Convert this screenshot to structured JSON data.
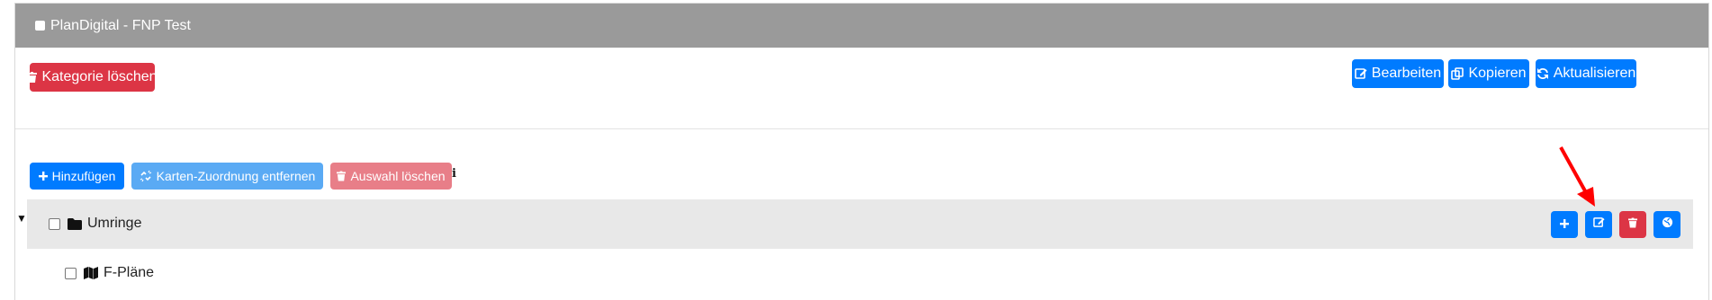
{
  "card": {
    "title": "PlanDigital - FNP Test"
  },
  "toolbar": {
    "delete_category_label": "Kategorie löschen",
    "edit_label": "Bearbeiten",
    "copy_label": "Kopieren",
    "refresh_label": "Aktualisieren"
  },
  "tree_toolbar": {
    "add_label": "Hinzufügen",
    "remove_map_assignment_label": "Karten-Zuordnung entfernen",
    "clear_selection_label": "Auswahl löschen",
    "info_icon": "info-icon"
  },
  "tree": {
    "items": [
      {
        "label": "Umringe",
        "icon": "folder-icon",
        "expanded": true
      },
      {
        "label": "F-Pläne",
        "icon": "map-icon"
      }
    ]
  },
  "row_actions": {
    "icons": [
      "plus-icon",
      "edit-icon",
      "trash-icon",
      "globe-icon"
    ]
  },
  "colors": {
    "header_bg": "#9a9a9a",
    "primary": "#007bff",
    "danger": "#dc3545",
    "info_light": "#5aaaf4",
    "danger_light": "#e87e88",
    "row_bg": "#e8e8e8",
    "annotation_arrow": "#ff0000"
  }
}
